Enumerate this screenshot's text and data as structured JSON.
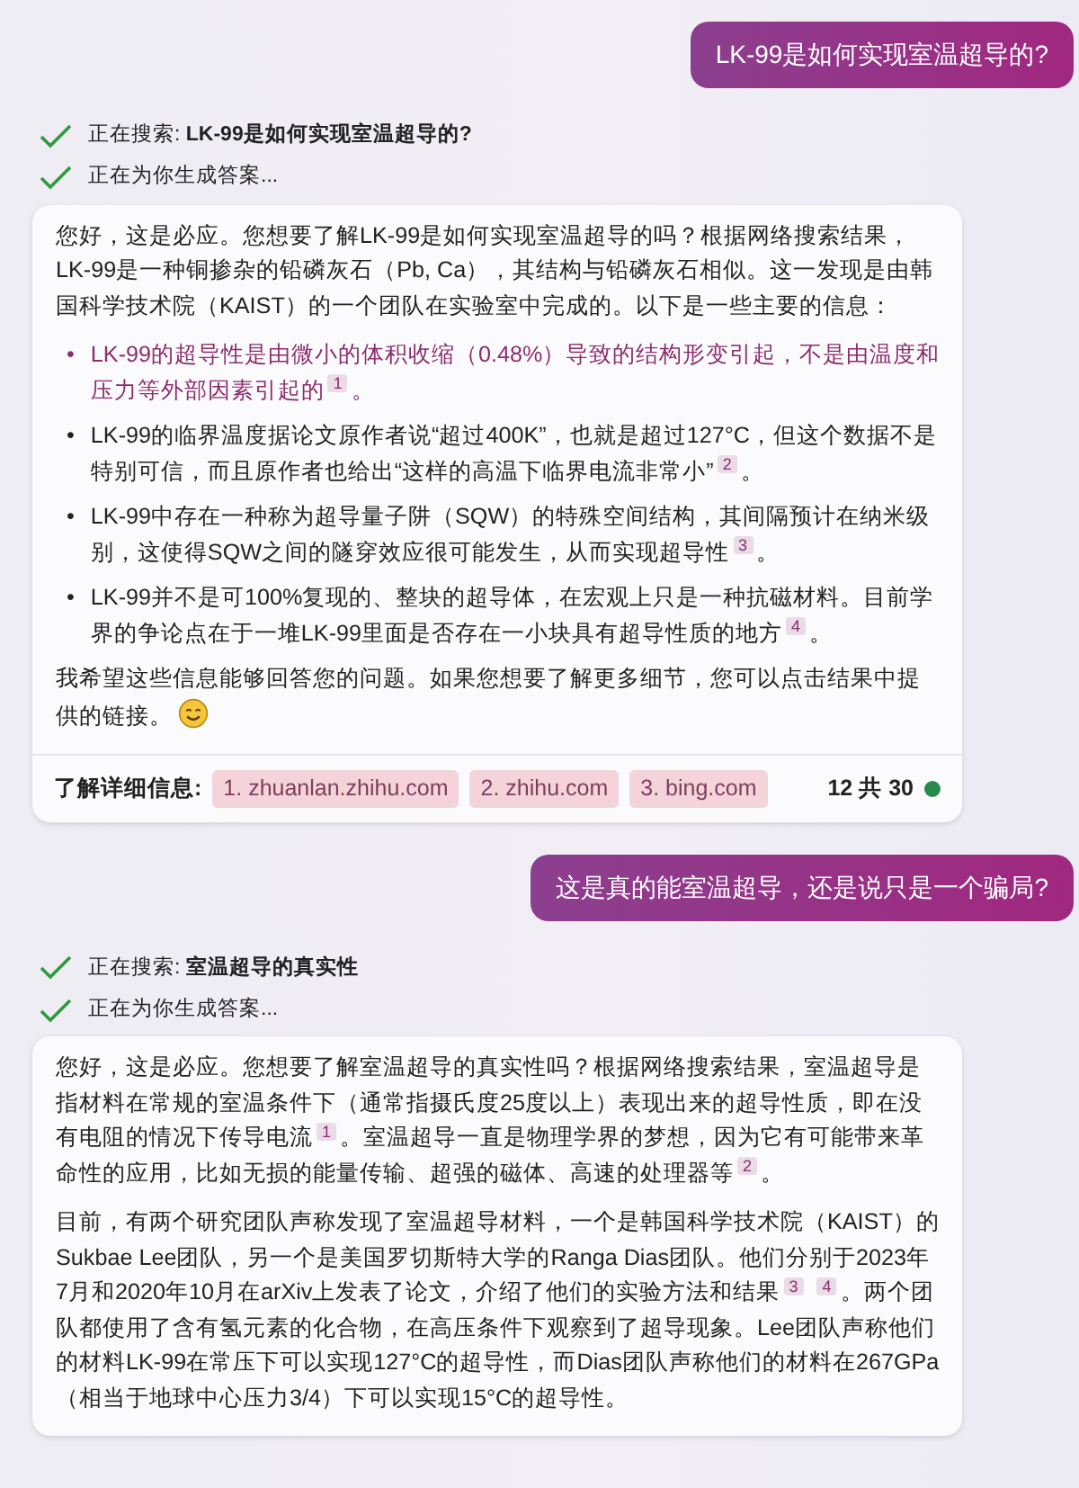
{
  "conversation": [
    {
      "kind": "user",
      "text": "LK-99是如何实现室温超导的?"
    },
    {
      "kind": "status",
      "steps": [
        {
          "text": "正在搜索: **LK-99是如何实现室温超导的?**",
          "done": true
        },
        {
          "text": "正在为你生成答案...",
          "done": true
        }
      ]
    },
    {
      "kind": "answer",
      "blocks": [
        {
          "kind": "paragraph",
          "text": "您好，这是必应。您想要了解LK-99是如何实现室温超导的吗？根据网络搜索结果，LK-99是一种铜掺杂的铅磷灰石（Pb, Ca），其结构与铅磷灰石相似。这一发现是由韩国科学技术院（KAIST）的一个团队在实验室中完成的。以下是一些主要的信息："
        },
        {
          "kind": "bullets",
          "marker": "•",
          "items": [
            {
              "text": "LK-99的超导性是由微小的体积收缩（0.48%）导致的结构形变引起，不是由温度和压力等外部因素引起的$^{1}$。",
              "highlighted": true
            },
            {
              "text": "LK-99的临界温度据论文原作者说“超过400K”，也就是超过127°C，但这个数据不是特别可信，而且原作者也给出“这样的高温下临界电流非常小”$^{2}$。",
              "highlighted": false
            },
            {
              "text": "LK-99中存在一种称为超导量子阱（SQW）的特殊空间结构，其间隔预计在纳米级别，这使得SQW之间的隧穿效应很可能发生，从而实现超导性$^{3}$。",
              "highlighted": false
            },
            {
              "text": "LK-99并不是可100%复现的、整块的超导体，在宏观上只是一种抗磁材料。目前学界的争论点在于一堆LK-99里面是否存在一小块具有超导性质的地方$^{4}$。",
              "highlighted": false
            }
          ]
        },
        {
          "kind": "paragraph",
          "text": "我希望这些信息能够回答您的问题。如果您想要了解更多细节，您可以点击结果中提供的链接。",
          "smiley": true
        }
      ],
      "learn_more": {
        "label": "了解详细信息:",
        "links": [
          "1. zhuanlan.zhihu.com",
          "2. zhihu.com",
          "3. bing.com"
        ]
      },
      "counter": "12 共 30"
    },
    {
      "kind": "user",
      "text": "这是真的能室温超导，还是说只是一个骗局?"
    },
    {
      "kind": "status",
      "steps": [
        {
          "text": "正在搜索: **室温超导的真实性**",
          "done": true
        },
        {
          "text": "正在为你生成答案...",
          "done": true
        }
      ]
    },
    {
      "kind": "answer",
      "blocks": [
        {
          "kind": "paragraph",
          "text": "您好，这是必应。您想要了解室温超导的真实性吗？根据网络搜索结果，室温超导是指材料在常规的室温条件下（通常指摄氏度25度以上）表现出来的超导性质，即在没有电阻的情况下传导电流$^{1}$。室温超导一直是物理学界的梦想，因为它有可能带来革命性的应用，比如无损的能量传输、超强的磁体、高速的处理器等$^{2}$。"
        },
        {
          "kind": "paragraph",
          "text": "目前，有两个研究团队声称发现了室温超导材料，一个是韩国科学技术院（KAIST）的Sukbae Lee团队，另一个是美国罗切斯特大学的Ranga Dias团队。他们分别于2023年7月和2020年10月在arXiv上发表了论文，介绍了他们的实验方法和结果$^{3}$ $^{4}$。两个团队都使用了含有氢元素的化合物，在高压条件下观察到了超导现象。Lee团队声称他们的材料LK-99在常压下可以实现127°C的超导性，而Dias团队声称他们的材料在267GPa（相当于地球中心压力3/4）下可以实现15°C的超导性。"
        }
      ]
    }
  ]
}
